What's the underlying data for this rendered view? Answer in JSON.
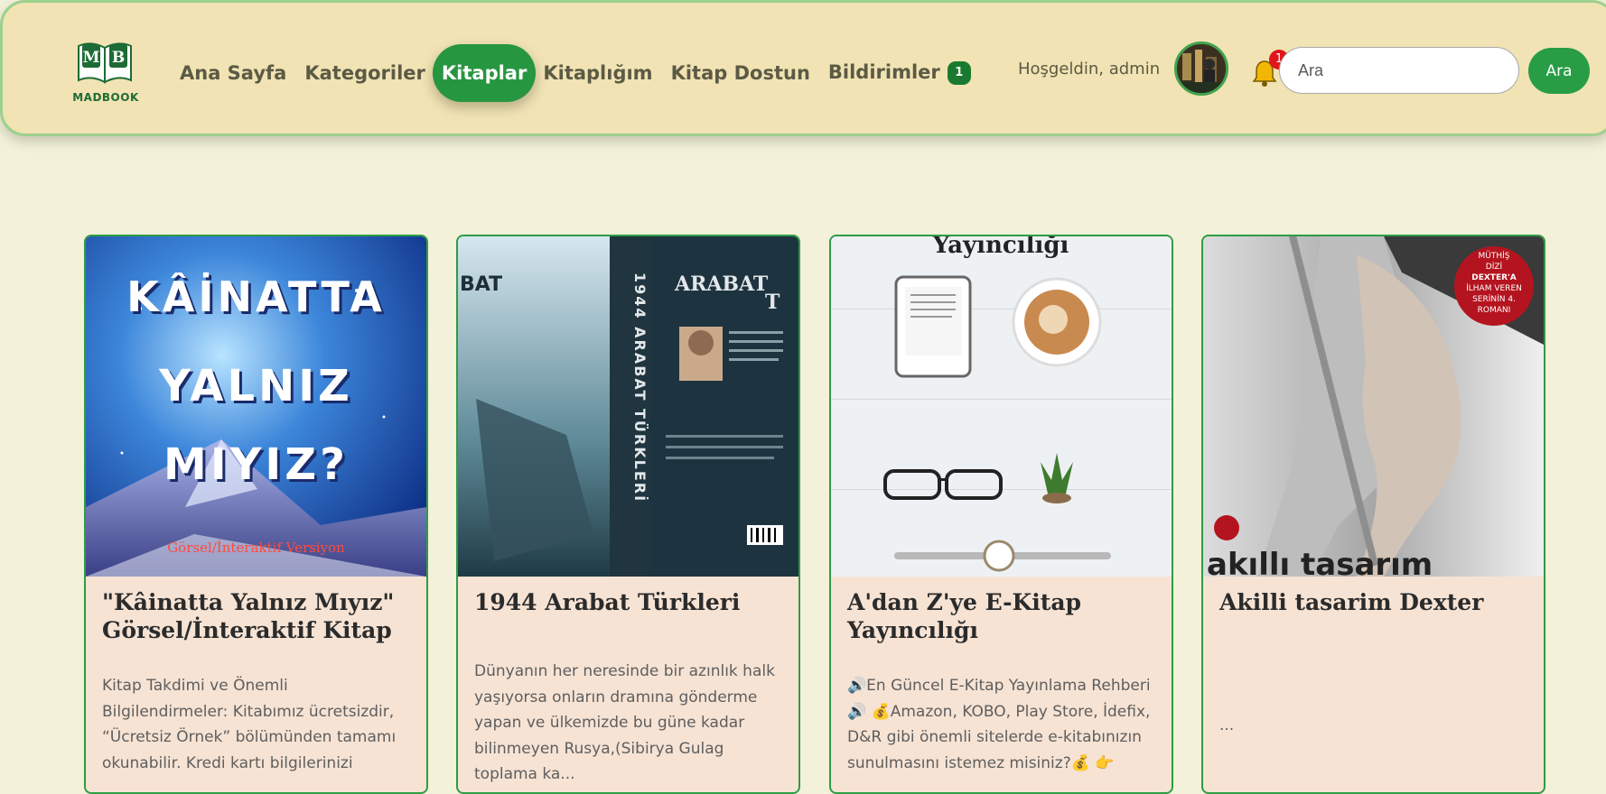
{
  "brand": {
    "name": "MADBOOK",
    "logo_letters": "MB"
  },
  "nav": {
    "items": [
      {
        "label": "Ana Sayfa"
      },
      {
        "label": "Kategoriler"
      },
      {
        "label": "Kitaplar",
        "active": true
      },
      {
        "label": "Kitaplığım"
      },
      {
        "label": "Kitap Dostun"
      },
      {
        "label": "Bildirimler",
        "badge": "1"
      }
    ]
  },
  "user": {
    "welcome": "Hoşgeldin, admin"
  },
  "notifications": {
    "count": "1"
  },
  "search": {
    "placeholder": "Ara",
    "button_label": "Ara"
  },
  "books": [
    {
      "title": "\"Kâinatta Yalnız Mıyız\" Görsel/İnteraktif Kitap",
      "description": "Kitap Takdimi ve Önemli Bilgilendirmeler: Kitabımız ücretsizdir, “Ücretsiz Örnek” bölümünden tamamı okunabilir. Kredi kartı bilgilerinizi",
      "cover_text": [
        "KÂİNATTA",
        "YALNIZ",
        "MIYIZ?"
      ],
      "cover_subtext": "Görsel/İnteraktif Versiyon"
    },
    {
      "title": "1944 Arabat Türkleri",
      "description": "Dünyanın her neresinde bir azınlık halk yaşıyorsa onların dramına gönderme yapan ve ülkemizde bu güne kadar bilinmeyen Rusya,(Sibirya Gulag toplama ka...",
      "cover_text": [
        "ARABAT",
        "TÜRKLERİ",
        "1944 ARABAT TÜRKLERİ"
      ]
    },
    {
      "title": "A'dan Z'ye E-Kitap Yayıncılığı",
      "description": "🔊En Güncel E-Kitap Yayınlama Rehberi 🔊 💰Amazon, KOBO, Play Store, İdefix, D&R gibi önemli sitelerde e-kitabınızın sunulmasını istemez misiniz?💰 👉",
      "cover_text": [
        "Yayıncılığı"
      ]
    },
    {
      "title": "Akilli tasarim Dexter",
      "description": "...",
      "cover_text": [
        "akıllı tasarım",
        "MÜTHİŞ DİZİ DEXTER'A İLHAM VEREN SERİNİN 4. ROMANI"
      ]
    }
  ]
}
